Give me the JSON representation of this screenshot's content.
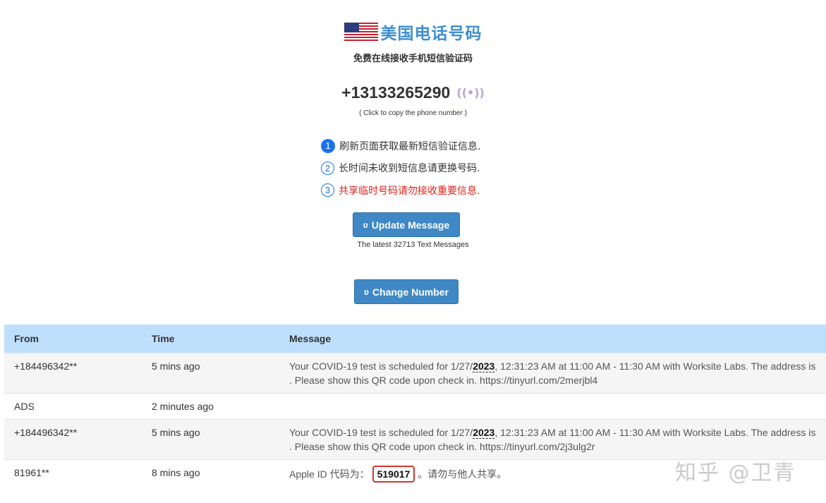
{
  "header": {
    "flag_icon": "us-flag-icon",
    "title": "美国电话号码",
    "subtitle": "免费在线接收手机短信验证码"
  },
  "phone": {
    "number": "+13133265290",
    "signal_icon": "broadcast-icon",
    "copy_hint": "( Click to copy the phone number )"
  },
  "tips": [
    {
      "num": "1",
      "text": "刷新页面获取最新短信验证信息.",
      "color": "#333333"
    },
    {
      "num": "2",
      "text": "长时间未收到短信息请更换号码.",
      "color": "#333333"
    },
    {
      "num": "3",
      "text": "共享临时号码请勿接收重要信息.",
      "color": "#e0201a"
    }
  ],
  "buttons": {
    "update_icon": "ʋ",
    "update_label": "Update Message",
    "latest_text": "The latest 32713 Text Messages",
    "change_icon": "ʋ",
    "change_label": "Change Number",
    "accent": "#3f88c5"
  },
  "table": {
    "headers": {
      "from": "From",
      "time": "Time",
      "message": "Message"
    },
    "header_bg": "#bfe0fc",
    "rows": [
      {
        "from": "+184496342**",
        "time": "5 mins ago",
        "msg_pre": "Your COVID-19 test is scheduled for 1/27/",
        "msg_year": "2023",
        "msg_post": ", 12:31:23 AM at 11:00 AM - 11:30 AM with Worksite Labs. The address is . Please show this QR code upon check in. https://tinyurl.com/2merjbl4"
      },
      {
        "from": "ADS",
        "time": "2 minutes ago",
        "msg": ""
      },
      {
        "from": "+184496342**",
        "time": "5 mins ago",
        "msg_pre": "Your COVID-19 test is scheduled for 1/27/",
        "msg_year": "2023",
        "msg_post": ", 12:31:23 AM at 11:00 AM - 11:30 AM with Worksite Labs. The address is . Please show this QR code upon check in. https://tinyurl.com/2j3ulg2r"
      },
      {
        "from": "81961**",
        "time": "8 mins ago",
        "msg_pre": "Apple ID 代码为：",
        "msg_code": "519017",
        "msg_post": "。请勿与他人共享。"
      }
    ]
  },
  "watermark": "知乎 @卫青"
}
